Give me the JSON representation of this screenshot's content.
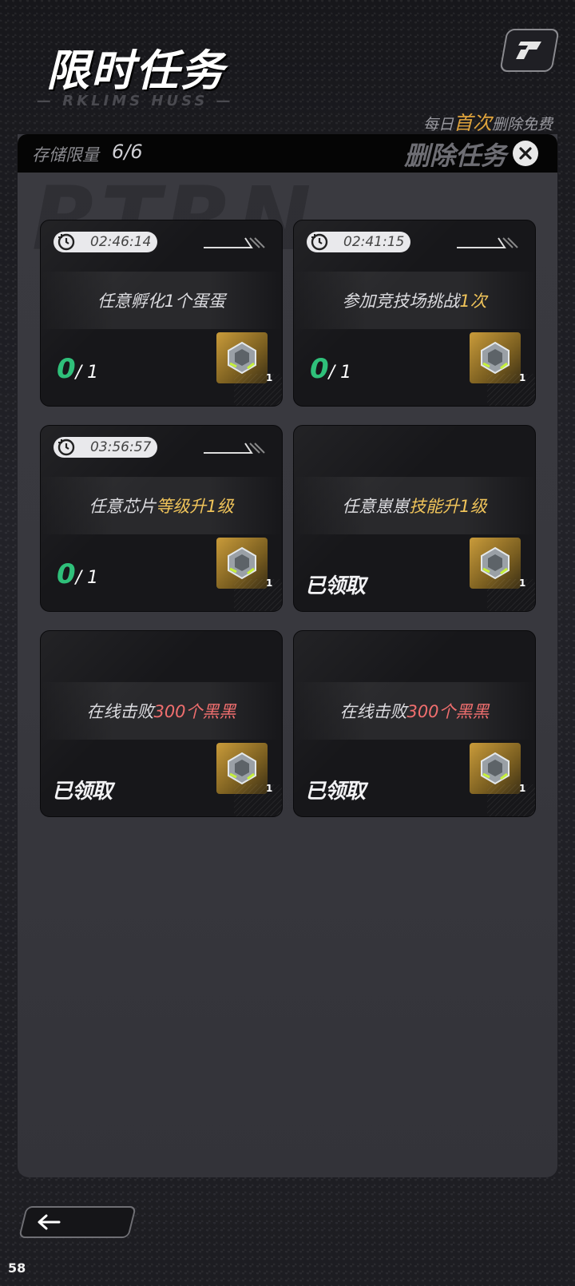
{
  "header": {
    "title": "限时任务",
    "subtitle": "— RKLIMS HUSS —",
    "free_note_prefix": "每日",
    "free_note_highlight": "首次",
    "free_note_suffix": "删除免费"
  },
  "storage": {
    "label": "存储限量",
    "value": "6/6",
    "delete_label": "删除任务"
  },
  "tasks": [
    {
      "timer": "02:46:14",
      "text_plain": "任意孵化1个蛋蛋",
      "text_hl": "",
      "hl_color": "gold",
      "progress_current": "0",
      "progress_total": "/ 1",
      "claimed": "",
      "reward_count": "1"
    },
    {
      "timer": "02:41:15",
      "text_plain": "参加竞技场挑战",
      "text_hl": "1次",
      "hl_color": "gold",
      "progress_current": "0",
      "progress_total": "/ 1",
      "claimed": "",
      "reward_count": "1"
    },
    {
      "timer": "03:56:57",
      "text_plain": "任意芯片",
      "text_hl": "等级升1级",
      "hl_color": "gold",
      "progress_current": "0",
      "progress_total": "/ 1",
      "claimed": "",
      "reward_count": "1"
    },
    {
      "timer": "",
      "text_plain": "任意崽崽",
      "text_hl": "技能升1级",
      "hl_color": "gold",
      "progress_current": "",
      "progress_total": "",
      "claimed": "已领取",
      "reward_count": "1"
    },
    {
      "timer": "",
      "text_plain": "在线击败",
      "text_hl": "300个黑黑",
      "hl_color": "red",
      "progress_current": "",
      "progress_total": "",
      "claimed": "已领取",
      "reward_count": "1"
    },
    {
      "timer": "",
      "text_plain": "在线击败",
      "text_hl": "300个黑黑",
      "hl_color": "red",
      "progress_current": "",
      "progress_total": "",
      "claimed": "已领取",
      "reward_count": "1"
    }
  ],
  "footer": {
    "fps": "58"
  },
  "colors": {
    "progress_green": "#2fc07a",
    "highlight_gold": "#f0c45a",
    "highlight_red": "#ef6e6e",
    "accent_orange": "#e0a43c"
  },
  "icons": {
    "timer": "clock-reset-icon",
    "delete": "close-icon",
    "back": "arrow-left-icon",
    "reward": "chip-reward-icon",
    "logo": "app-logo-icon"
  }
}
